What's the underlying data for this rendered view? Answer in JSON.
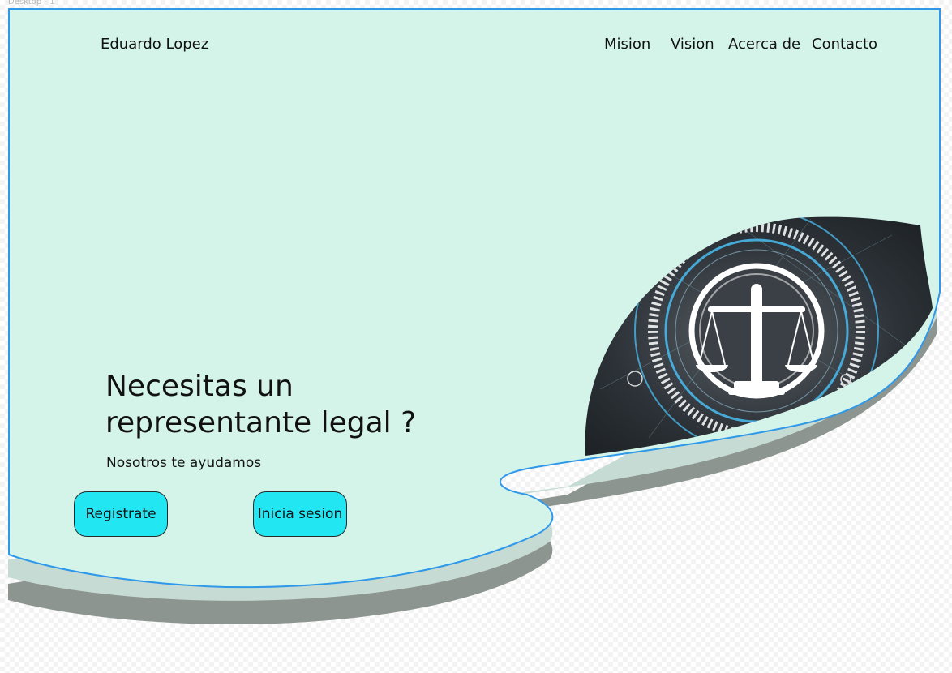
{
  "frame": {
    "label": "Desktop - 1"
  },
  "header": {
    "brand": "Eduardo Lopez",
    "nav": [
      "Mision",
      "Vision",
      "Acerca de",
      "Contacto"
    ]
  },
  "hero": {
    "title_line1": "Necesitas un",
    "title_line2": "representante legal ?",
    "subtitle": "Nosotros te ayudamos",
    "buttons": {
      "register": "Registrate",
      "login": "Inicia sesion"
    }
  },
  "colors": {
    "background": "#d4f4ea",
    "frame_border": "#2f98e8",
    "button": "#22e6f2",
    "shadow_light": "#c5dbd3",
    "shadow_dark": "#8d9590",
    "image_glow": "#48b6e8"
  },
  "image": {
    "icon": "scales-of-justice-icon"
  }
}
